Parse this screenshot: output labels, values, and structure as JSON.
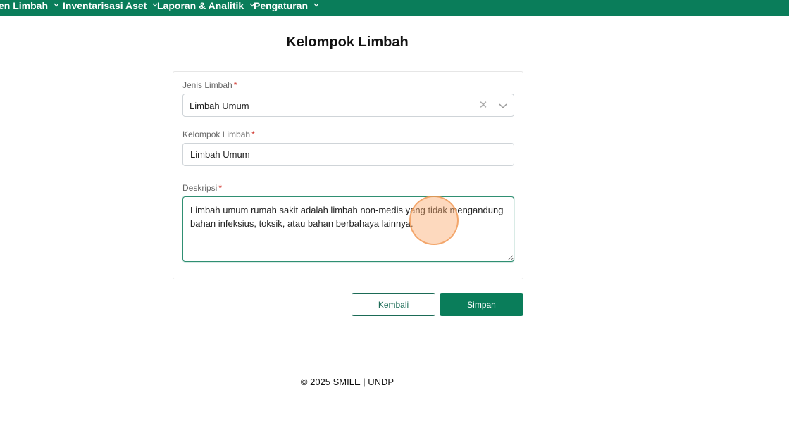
{
  "nav": {
    "items": [
      {
        "label": "en Limbah"
      },
      {
        "label": "Inventarisasi Aset"
      },
      {
        "label": "Laporan & Analitik"
      },
      {
        "label": "Pengaturan"
      }
    ],
    "icon": "chevron-down-icon"
  },
  "page": {
    "title": "Kelompok Limbah"
  },
  "form": {
    "jenis_limbah": {
      "label": "Jenis Limbah",
      "required_mark": "*",
      "value": "Limbah Umum",
      "clear_icon": "✕"
    },
    "kelompok_limbah": {
      "label": "Kelompok Limbah",
      "required_mark": "*",
      "value": "Limbah Umum"
    },
    "deskripsi": {
      "label": "Deskripsi",
      "required_mark": "*",
      "value": "Limbah umum rumah sakit adalah limbah non-medis yang tidak mengandung bahan infeksius, toksik, atau bahan berbahaya lainnya."
    }
  },
  "actions": {
    "back_label": "Kembali",
    "save_label": "Simpan"
  },
  "footer": {
    "text": "© 2025 SMILE | UNDP"
  },
  "colors": {
    "brand": "#0a7d5a",
    "required": "#d0342c"
  }
}
